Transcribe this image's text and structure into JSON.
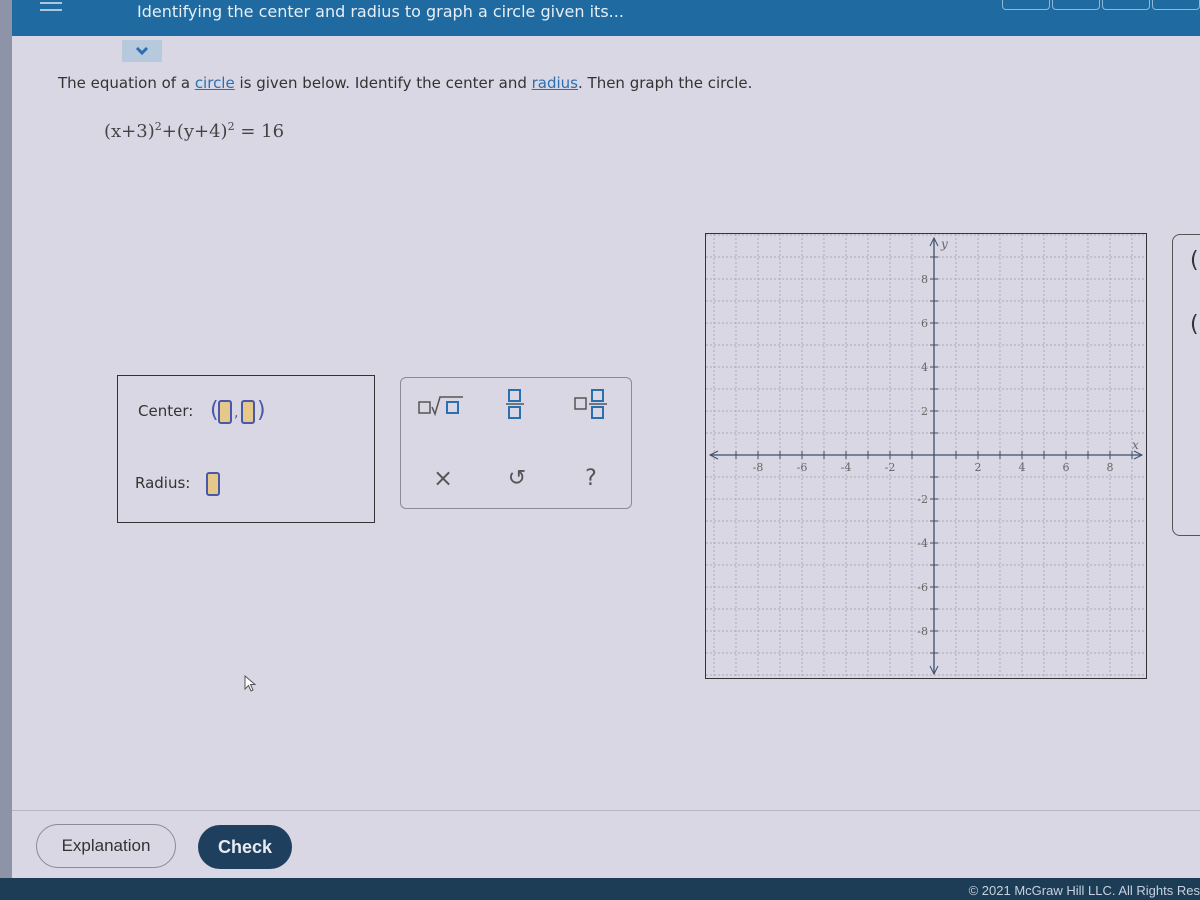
{
  "header": {
    "title": "Identifying the center and radius to graph a circle given its...",
    "menu_icon": "hamburger-menu-icon",
    "collapse_icon": "chevron-down-icon",
    "colors": {
      "bar": "#1f6aa0",
      "footer": "#1d3c55",
      "check_button": "#1f3f5f",
      "link": "#2a6fb0",
      "input_fill": "#e6c98a",
      "input_border": "#4a58a8"
    }
  },
  "question": {
    "prompt_parts": [
      "The equation of a ",
      "circle",
      " is given below. Identify the center and ",
      "radius",
      ". Then graph the circle."
    ],
    "equation": {
      "part1": "(x+3)",
      "exp1": "2",
      "plus": "+",
      "part2": "(y+4)",
      "exp2": "2",
      "rhs": "= 16"
    }
  },
  "answer": {
    "center_label": "Center:",
    "center_x_value": "",
    "center_y_value": "",
    "center_separator": ",",
    "radius_label": "Radius:",
    "radius_value": ""
  },
  "toolbox": {
    "tools": [
      {
        "name": "square-root-icon",
        "title": "Square root"
      },
      {
        "name": "fraction-icon",
        "title": "Fraction"
      },
      {
        "name": "mixed-number-icon",
        "title": "Mixed number"
      },
      {
        "name": "clear-icon",
        "title": "Clear"
      },
      {
        "name": "undo-icon",
        "title": "Undo"
      },
      {
        "name": "help-icon",
        "title": "Help"
      }
    ],
    "glyphs": {
      "clear": "×",
      "undo": "↺",
      "help": "?"
    }
  },
  "graph": {
    "x_axis_label": "x",
    "y_axis_label": "y",
    "x_range": [
      -10,
      10
    ],
    "y_range": [
      -10,
      10
    ],
    "x_ticks": [
      "-8",
      "-6",
      "-4",
      "-2",
      "2",
      "4",
      "6",
      "8"
    ],
    "y_ticks": [
      "8",
      "6",
      "4",
      "2",
      "-2",
      "-4",
      "-6",
      "-8"
    ],
    "grid": true
  },
  "buttons": {
    "explanation": "Explanation",
    "check": "Check"
  },
  "footer": {
    "copyright": "© 2021 McGraw Hill LLC. All Rights Res"
  }
}
